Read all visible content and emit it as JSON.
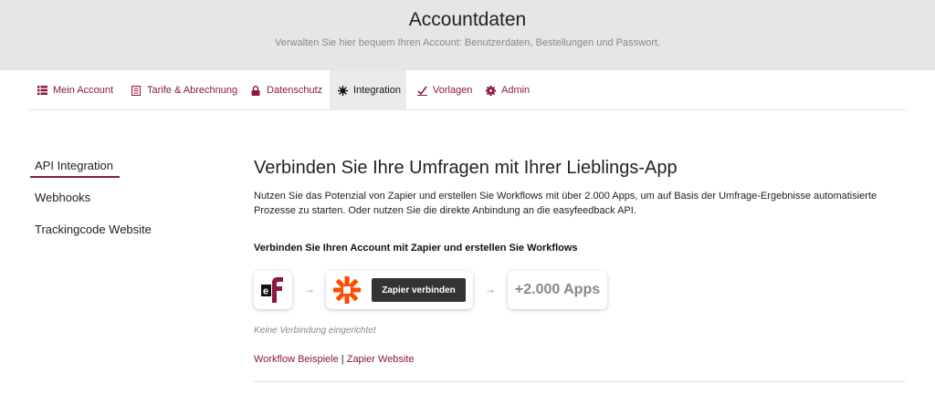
{
  "header": {
    "title": "Accountdaten",
    "subtitle": "Verwalten Sie hier bequem Ihren Account: Benutzerdaten, Bestellungen und Passwort."
  },
  "tabs": [
    {
      "label": "Mein Account",
      "icon": "list-icon",
      "active": false
    },
    {
      "label": "Tarife & Abrechnung",
      "icon": "document-icon",
      "active": false
    },
    {
      "label": "Datenschutz",
      "icon": "lock-icon",
      "active": false
    },
    {
      "label": "Integration",
      "icon": "gear-icon",
      "active": true
    },
    {
      "label": "Vorlagen",
      "icon": "template-icon",
      "active": false
    },
    {
      "label": "Admin",
      "icon": "cog-icon",
      "active": false
    }
  ],
  "sidebar": {
    "items": [
      {
        "label": "API Integration",
        "active": true
      },
      {
        "label": "Webhooks",
        "active": false
      },
      {
        "label": "Trackingcode Website",
        "active": false
      }
    ]
  },
  "main": {
    "title": "Verbinden Sie Ihre Umfragen mit Ihrer Lieblings-App",
    "description": "Nutzen Sie das Potenzial von Zapier und erstellen Sie Workflows mit über 2.000 Apps, um auf Basis der Umfrage-Ergebnisse automatisierte Prozesse zu starten. Oder nutzen Sie die direkte Anbindung an die easyfeedback API.",
    "section_title": "Verbinden Sie Ihren Account mit Zapier und erstellen Sie Workflows",
    "connect_button": "Zapier verbinden",
    "apps_count": "+2.000 Apps",
    "status": "Keine Verbindung eingerichtet",
    "links": {
      "workflow": "Workflow Beispiele",
      "separator": "|",
      "zapier": "Zapier Website"
    }
  },
  "colors": {
    "accent": "#8b1a3d",
    "zapier_orange": "#ff4a00",
    "header_bg": "#e6e6e6"
  }
}
